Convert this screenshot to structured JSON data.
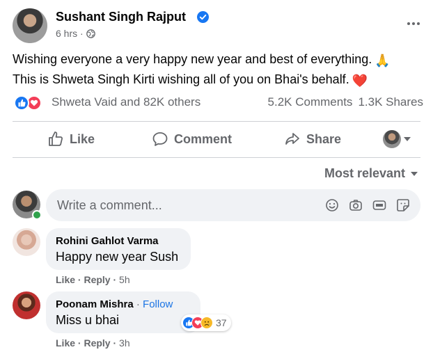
{
  "post": {
    "author": "Sushant Singh Rajput",
    "time": "6 hrs",
    "text_line1": "Wishing everyone a very happy new year and best of everything.",
    "text_line2": "This is Shweta Singh Kirti wishing all of you on Bhai's behalf.",
    "emoji1": "🙏",
    "emoji2": "❤️"
  },
  "summary": {
    "reactors": "Shweta Vaid and 82K others",
    "comments": "5.2K Comments",
    "shares": "1.3K Shares"
  },
  "actions": {
    "like": "Like",
    "comment": "Comment",
    "share": "Share"
  },
  "sort": {
    "label": "Most relevant"
  },
  "composer": {
    "placeholder": "Write a comment..."
  },
  "comments": [
    {
      "name": "Rohini Gahlot Varma",
      "text": "Happy new year Sush",
      "like": "Like",
      "reply": "Reply",
      "time": "5h"
    },
    {
      "name": "Poonam Mishra",
      "follow": "Follow",
      "text": "Miss u bhai",
      "like": "Like",
      "reply": "Reply",
      "time": "3h",
      "reaction_count": "37"
    }
  ],
  "colors": {
    "like_blue": "#1877f2",
    "love_red": "#f33e58",
    "follow_blue": "#1b74e4",
    "muted": "#65676b"
  }
}
